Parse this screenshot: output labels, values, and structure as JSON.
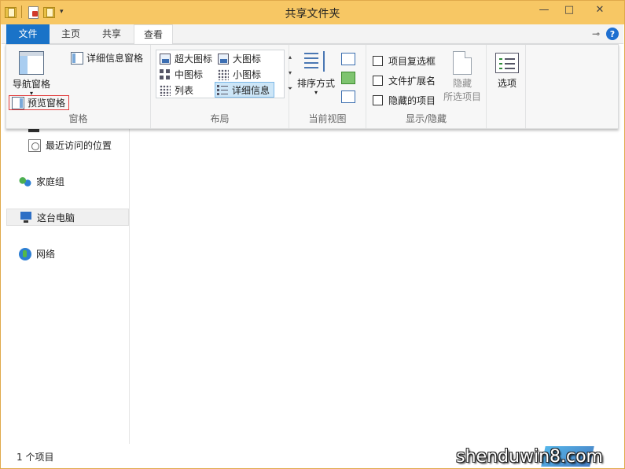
{
  "window": {
    "title": "共享文件夹",
    "controls": {
      "minimize": "—",
      "maximize": "□",
      "close": "✕"
    }
  },
  "colors": {
    "titlebar": "#f7c764",
    "file_tab": "#1a73c8",
    "selection": "#cde6f7",
    "highlight_box": "#e13a3a"
  },
  "quick_access": {
    "dropdown": "▾"
  },
  "tabs": [
    {
      "label": "文件"
    },
    {
      "label": "主页"
    },
    {
      "label": "共享"
    },
    {
      "label": "查看"
    }
  ],
  "tabbar_right": {
    "pin_glyph": "⊸",
    "help_glyph": "?"
  },
  "ribbon": {
    "panes": {
      "label": "窗格",
      "nav_pane": "导航窗格",
      "nav_pane_arrow": "▾",
      "preview_pane": "预览窗格",
      "details_pane": "详细信息窗格"
    },
    "layout": {
      "label": "布局",
      "items": [
        {
          "label": "超大图标",
          "icon": "extra-large-icons-icon"
        },
        {
          "label": "大图标",
          "icon": "large-icons-icon"
        },
        {
          "label": "中图标",
          "icon": "medium-icons-icon"
        },
        {
          "label": "小图标",
          "icon": "small-icons-icon"
        },
        {
          "label": "列表",
          "icon": "list-icon"
        },
        {
          "label": "详细信息",
          "icon": "details-icon",
          "selected": true
        }
      ],
      "scroll": {
        "up": "▴",
        "down": "▾",
        "more": "⏷"
      }
    },
    "current_view": {
      "label": "当前视图",
      "sort_by": "排序方式",
      "sort_arrow": "▾"
    },
    "show_hide": {
      "label": "显示/隐藏",
      "item_checkboxes": "项目复选框",
      "file_extensions": "文件扩展名",
      "hidden_items": "隐藏的项目",
      "hide_selected_line1": "隐藏",
      "hide_selected_line2": "所选项目"
    },
    "options": {
      "label": "选项"
    }
  },
  "nav_pane": {
    "items": [
      {
        "label": "最近访问的位置",
        "icon": "recent-places-icon"
      },
      {
        "label": "家庭组",
        "icon": "homegroup-icon"
      },
      {
        "label": "这台电脑",
        "icon": "this-pc-icon",
        "selected": true
      },
      {
        "label": "网络",
        "icon": "network-icon"
      }
    ]
  },
  "status_bar": {
    "item_count": "1 个项目",
    "watermark": "shenduwin8.com"
  }
}
